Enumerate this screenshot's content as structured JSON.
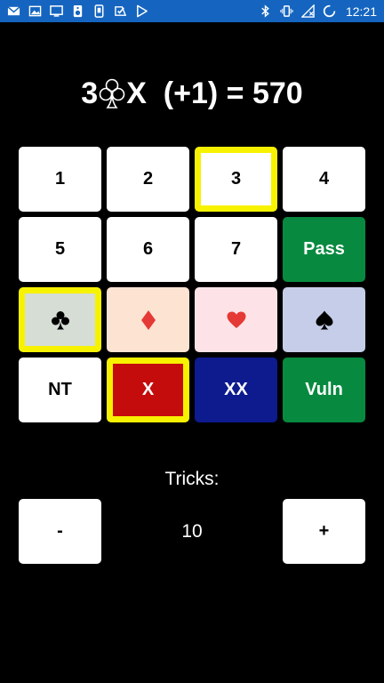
{
  "status_bar": {
    "time": "12:21",
    "left_icons": [
      "mail-icon",
      "photo-icon",
      "monitor-icon",
      "speaker-icon",
      "phone-icon",
      "check-icon",
      "play-store-icon"
    ],
    "right_icons": [
      "bluetooth-icon",
      "vibrate-icon",
      "no-signal-icon",
      "battery-charging-icon"
    ],
    "color": "#1565C0"
  },
  "contract": {
    "level": "3",
    "suit_icon": "club-outline-icon",
    "doubled": "X",
    "overtricks": "(+1)",
    "equals": "=",
    "score": "570"
  },
  "keypad": {
    "levels": [
      "1",
      "2",
      "3",
      "4",
      "5",
      "6",
      "7"
    ],
    "selected_level": "3",
    "pass_label": "Pass",
    "suits": [
      {
        "name": "clubs",
        "icon": "club-icon",
        "color": "#000000",
        "bg": "#D5DDD5"
      },
      {
        "name": "diamonds",
        "icon": "diamond-icon",
        "color": "#E53935",
        "bg": "#FDE3D2"
      },
      {
        "name": "hearts",
        "icon": "heart-icon",
        "color": "#E53935",
        "bg": "#FDE3E7"
      },
      {
        "name": "spades",
        "icon": "spade-icon",
        "color": "#000000",
        "bg": "#C5CDE9"
      }
    ],
    "selected_suit": "clubs",
    "nt_label": "NT",
    "double_label": "X",
    "redouble_label": "XX",
    "vuln_label": "Vuln",
    "selected_double": "X",
    "colors": {
      "highlight": "#F7F200",
      "pass_bg": "#078A3F",
      "double_bg": "#C40C0C",
      "redouble_bg": "#0D1B8E",
      "vuln_bg": "#078A3F",
      "key_bg": "#FFFFFF"
    }
  },
  "tricks": {
    "label": "Tricks:",
    "minus_label": "-",
    "value": "10",
    "plus_label": "+"
  }
}
